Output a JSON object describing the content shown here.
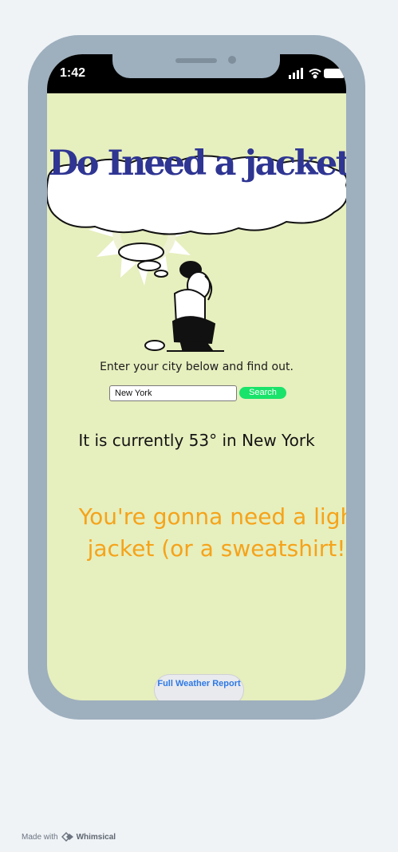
{
  "status_bar": {
    "time": "1:42"
  },
  "app": {
    "title_words": [
      "Do",
      "I",
      "need",
      "a",
      "jacket"
    ],
    "intro": "Enter your city below and find out.",
    "search": {
      "value": "New York",
      "button_label": "Search"
    },
    "current_weather": "It is currently 53° in New York",
    "verdict_line1": "You're gonna need a light",
    "verdict_line2": "jacket (or a sweatshirt!)",
    "full_report_label": "Full Weather Report",
    "colors": {
      "background": "#e6efbe",
      "title": "#2e3592",
      "verdict": "#f5a31a",
      "button": "#19e36a",
      "link": "#2e79e6"
    }
  },
  "footer": {
    "made_with": "Made with",
    "brand": "Whimsical"
  },
  "icons": [
    "signal-icon",
    "wifi-icon",
    "battery-icon",
    "whimsical-logo-icon"
  ]
}
